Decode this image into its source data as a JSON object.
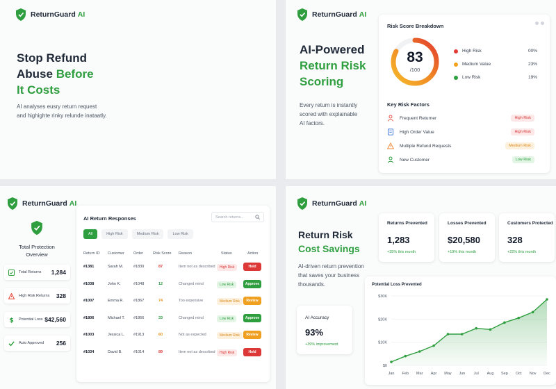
{
  "brand": {
    "name": "ReturnGuard",
    "ai": "AI"
  },
  "hero": {
    "title_line1": "Stop Refund",
    "title_line2a": "Abuse",
    "title_line2b": "Before",
    "title_line3": "It Costs",
    "subtitle_line1": "AI analyses eusry return request",
    "subtitle_line2": "and highighte rinky relunde inataatly."
  },
  "scoring": {
    "title_line1": "AI-Powered",
    "title_line2": "Return Risk",
    "title_line3": "Scoring",
    "subtitle_line1": "Every return is instantly",
    "subtitle_line2": "scored with explainable",
    "subtitle_line3": "AI factors."
  },
  "risk_card": {
    "title": "Risk Score Breakdown",
    "score": "83",
    "score_max": "/100",
    "score_value": 83,
    "legend": [
      {
        "label": "High Risk",
        "value": "00%",
        "color": "#e53935"
      },
      {
        "label": "Medium Value",
        "value": "23%",
        "color": "#f4a21b"
      },
      {
        "label": "Low Risk",
        "value": "19%",
        "color": "#2e9e3f"
      }
    ],
    "factors_title": "Key Risk Factors",
    "factors": [
      {
        "label": "Frequent Returner",
        "badge": "High Risk",
        "level": "high",
        "icon": "user-icon"
      },
      {
        "label": "High Order Value",
        "badge": "High Risk",
        "level": "high",
        "icon": "document-icon"
      },
      {
        "label": "Multiple Refund Requests",
        "badge": "Medium Risk",
        "level": "med",
        "icon": "warning-icon"
      },
      {
        "label": "New Customer",
        "badge": "Low Risk",
        "level": "low",
        "icon": "user-icon"
      }
    ]
  },
  "protection": {
    "title_line1": "Total Protection",
    "title_line2": "Overview",
    "stats": [
      {
        "label": "Total Returns",
        "value": "1,284",
        "icon": "checkbox-icon"
      },
      {
        "label": "High Risk Returns",
        "value": "328",
        "icon": "warning-icon"
      },
      {
        "label": "Potential Loss",
        "value": "$42,560",
        "icon": "dollar-icon"
      },
      {
        "label": "Auto Approved",
        "value": "256",
        "icon": "check-icon"
      }
    ]
  },
  "responses": {
    "title": "AI Return Responses",
    "search_placeholder": "Search returns...",
    "filters": [
      "All",
      "High Risk",
      "Medium Risk",
      "Low Risk"
    ],
    "columns": [
      "Return ID",
      "Customer",
      "Order",
      "Risk Score",
      "Reason",
      "Status",
      "Action"
    ],
    "rows": [
      {
        "id": "#1381",
        "customer": "Sarah M.",
        "order": "#1830",
        "score": "87",
        "reason": "Item not as described",
        "status": "High Risk",
        "level": "high",
        "action": "Hold",
        "act": "hold"
      },
      {
        "id": "#1038",
        "customer": "John K.",
        "order": "#1048",
        "score": "12",
        "reason": "Changed mind",
        "status": "Low Risk",
        "level": "low",
        "action": "Approve",
        "act": "approve"
      },
      {
        "id": "#1007",
        "customer": "Emma R.",
        "order": "#1867",
        "score": "74",
        "reason": "Too expensive",
        "status": "Medium Risk",
        "level": "med",
        "action": "Review",
        "act": "review"
      },
      {
        "id": "#1806",
        "customer": "Michael T.",
        "order": "#1866",
        "score": "33",
        "reason": "Changed mind",
        "status": "Low Risk",
        "level": "low",
        "action": "Approve",
        "act": "approve"
      },
      {
        "id": "#1003",
        "customer": "Jessica L.",
        "order": "#1913",
        "score": "60",
        "reason": "Not as expected",
        "status": "Medium Risk",
        "level": "med",
        "action": "Review",
        "act": "review"
      },
      {
        "id": "#1034",
        "customer": "David B.",
        "order": "#1014",
        "score": "89",
        "reason": "Item not as described",
        "status": "High Risk",
        "level": "high",
        "action": "Hold",
        "act": "hold"
      }
    ]
  },
  "savings": {
    "title_line1": "Return Risk",
    "title_line2": "Cost Savings",
    "subtitle_line1": "AI-driven return prevention",
    "subtitle_line2": "that saves your business",
    "subtitle_line3": "thousands.",
    "metrics": [
      {
        "label": "Returns Prevented",
        "value": "1,283",
        "delta": "+35% this month"
      },
      {
        "label": "Losses Prevented",
        "value": "$20,580",
        "delta": "+19% this month"
      },
      {
        "label": "Customers Protected",
        "value": "328",
        "delta": "+22% this month"
      }
    ],
    "accuracy": {
      "label": "AI Accuracy",
      "value": "93%",
      "delta": "+39% improvement"
    }
  },
  "chart_data": {
    "type": "area",
    "title": "Potential Loss Prevented",
    "categories": [
      "Jan",
      "Feb",
      "Mar",
      "Apr",
      "May",
      "Jun",
      "Jul",
      "Aug",
      "Sep",
      "Oct",
      "Nov",
      "Dec"
    ],
    "values": [
      1500,
      4000,
      6000,
      8500,
      13500,
      13500,
      16000,
      15500,
      18500,
      20500,
      23000,
      28500
    ],
    "y_ticks": [
      "$0",
      "$10K",
      "$20K",
      "$30K"
    ],
    "ylim": [
      0,
      30000
    ],
    "color": "#2e9e3f"
  }
}
